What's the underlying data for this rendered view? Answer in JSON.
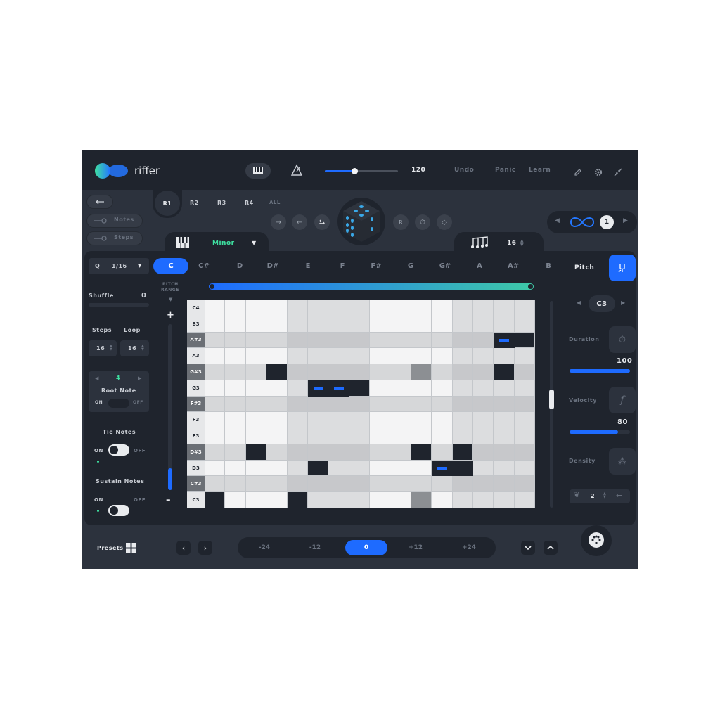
{
  "header": {
    "app_name": "riffer",
    "tempo": "120",
    "tempo_fraction": 0.4,
    "undo": "Undo",
    "panic": "Panic",
    "learn": "Learn"
  },
  "riff_tabs": [
    "R1",
    "R2",
    "R3",
    "R4",
    "ALL"
  ],
  "lock_controls": {
    "notes": "Notes",
    "steps": "Steps"
  },
  "scale": {
    "name": "Minor"
  },
  "steps_selector": {
    "value": "16"
  },
  "loop_count": "1",
  "quantize": {
    "label": "Q",
    "value": "1/16"
  },
  "shuffle": {
    "label": "Shuffle",
    "value": "0"
  },
  "steps_loop": {
    "steps_label": "Steps",
    "loop_label": "Loop",
    "steps": "16",
    "loop": "16"
  },
  "root_note": {
    "value": "4",
    "label": "Root Note",
    "on": "ON",
    "off": "OFF"
  },
  "tie_notes": {
    "label": "Tie Notes",
    "on": "ON",
    "off": "OFF"
  },
  "sustain_notes": {
    "label": "Sustain Notes",
    "on": "ON",
    "off": "OFF"
  },
  "pitch_range": {
    "label1": "PITCH",
    "label2": "RANGE",
    "plus": "+",
    "minus": "–",
    "fraction": 0.1
  },
  "keys": [
    "C",
    "C#",
    "D",
    "D#",
    "E",
    "F",
    "F#",
    "G",
    "G#",
    "A",
    "A#",
    "B"
  ],
  "selected_key": "C",
  "note_rows": [
    "C4",
    "B3",
    "A#3",
    "A3",
    "G#3",
    "G3",
    "F#3",
    "F3",
    "E3",
    "D#3",
    "D3",
    "C#3",
    "C3"
  ],
  "right_panel": {
    "pitch": "Pitch",
    "pitch_note": "C3",
    "duration": "Duration",
    "duration_value": "100",
    "duration_fraction": 1.0,
    "velocity": "Velocity",
    "velocity_value": "80",
    "velocity_fraction": 0.8,
    "density": "Density",
    "density_value": "2"
  },
  "footer": {
    "presets": "Presets",
    "transpose": [
      "-24",
      "-12",
      "0",
      "+12",
      "+24"
    ],
    "selected_transpose": "0"
  },
  "colors": {
    "accent": "#1e6bff",
    "teal": "#3ec9a7",
    "bg": "#2c323d",
    "panel": "#1f242d"
  }
}
